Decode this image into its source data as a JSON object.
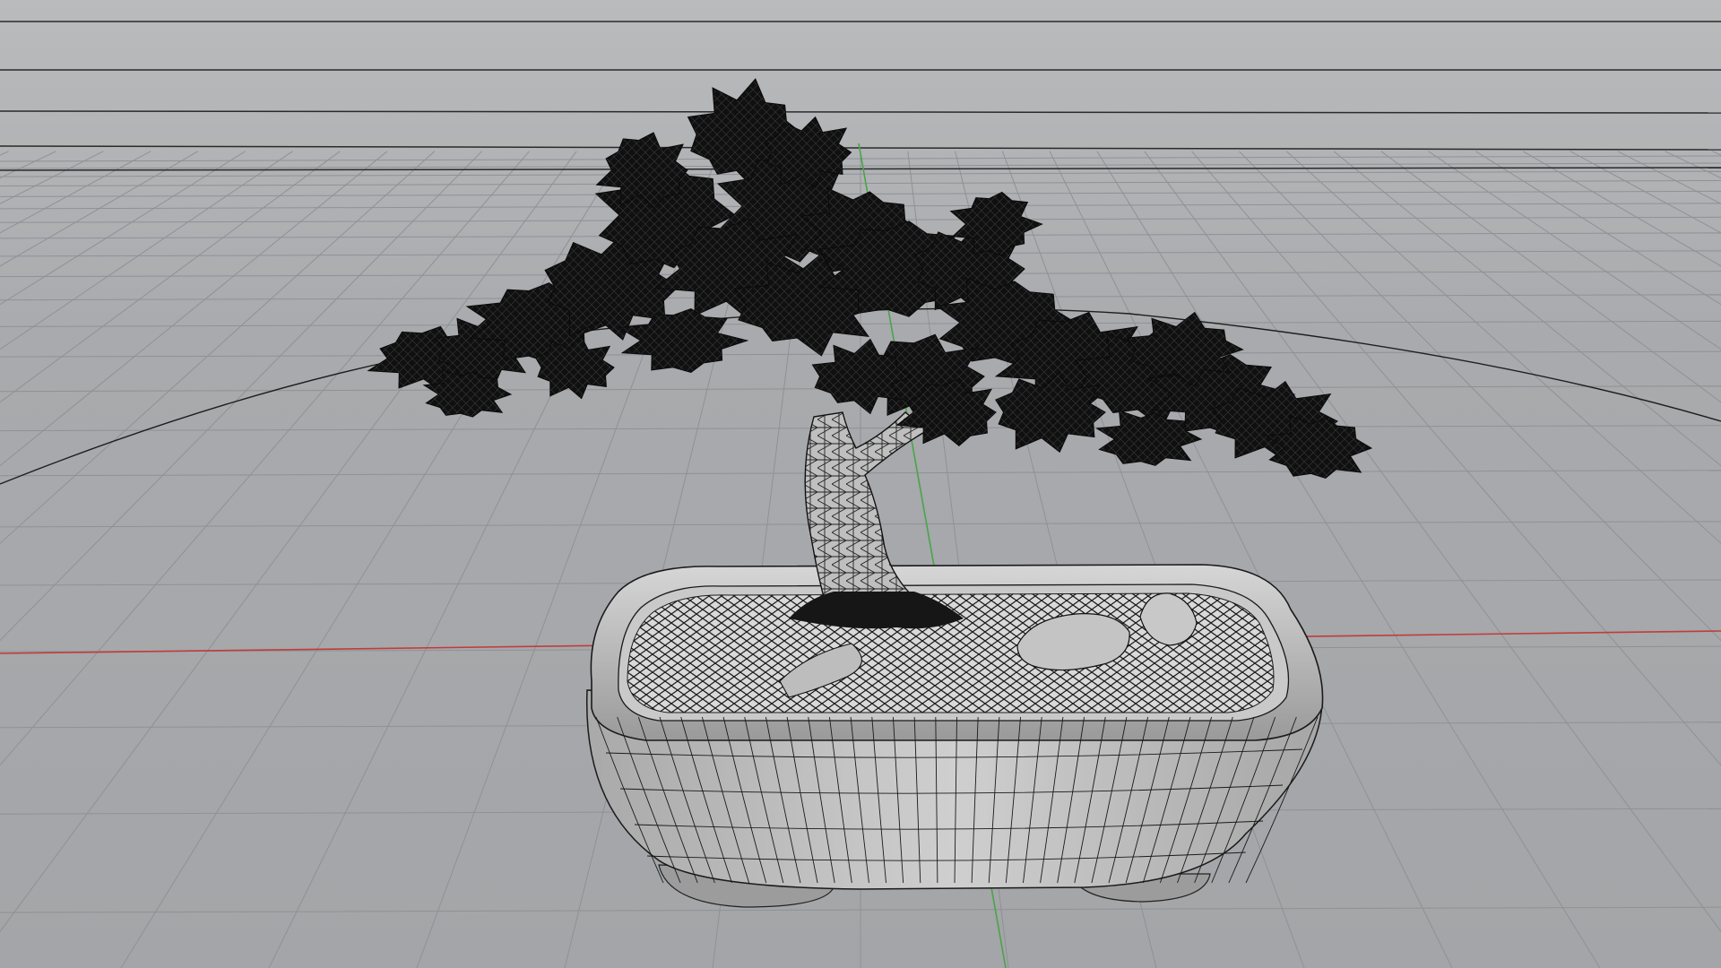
{
  "app": {
    "view": "3d-viewport"
  },
  "viewport": {
    "background_color": "#a9abae",
    "grid_color": "#8f9194",
    "horizon_line_color": "#2a2a2a",
    "x_axis_color": "#c23b3b",
    "y_axis_color": "#4aa34a",
    "wire_color": "#111111",
    "shading": "wireframe-on-shaded"
  },
  "scene": {
    "object": "bonsai-tree-in-pot"
  }
}
